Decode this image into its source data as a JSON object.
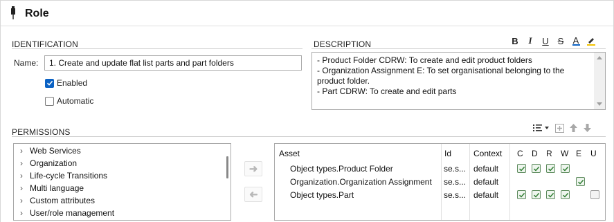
{
  "header": {
    "title": "Role",
    "icon": "pin-icon"
  },
  "identification": {
    "section_label": "IDENTIFICATION",
    "name_label": "Name:",
    "name_value": "1. Create and update flat list parts and part folders",
    "enabled_label": "Enabled",
    "enabled_checked": true,
    "automatic_label": "Automatic",
    "automatic_checked": false
  },
  "description": {
    "section_label": "DESCRIPTION",
    "toolbar": [
      "B",
      "I",
      "U",
      "S",
      "A",
      "highlight"
    ],
    "text": "- Product Folder CDRW: To create and edit product folders\n- Organization Assignment E: To set organisational belonging to the\nproduct folder.\n- Part CDRW: To create and edit parts"
  },
  "permissions": {
    "section_label": "PERMISSIONS",
    "tree_items": [
      "Web Services",
      "Organization",
      "Life-cycle Transitions",
      "Multi language",
      "Custom attributes",
      "User/role management"
    ],
    "grid": {
      "columns": [
        "Asset",
        "Id",
        "Context",
        "C",
        "D",
        "R",
        "W",
        "E",
        "U"
      ],
      "rows": [
        {
          "asset": "Object types.Product Folder",
          "id": "se.s...",
          "context": "default",
          "flags": [
            1,
            1,
            1,
            1,
            0,
            0
          ]
        },
        {
          "asset": "Organization.Organization Assignment",
          "id": "se.s...",
          "context": "default",
          "flags": [
            0,
            0,
            0,
            0,
            1,
            0
          ]
        },
        {
          "asset": "Object types.Part",
          "id": "se.s...",
          "context": "default",
          "flags": [
            1,
            1,
            1,
            1,
            0,
            2
          ]
        }
      ]
    }
  },
  "colors": {
    "accent": "#0b62c4",
    "check_green": "#2f7d32",
    "border": "#a9a9a9"
  }
}
